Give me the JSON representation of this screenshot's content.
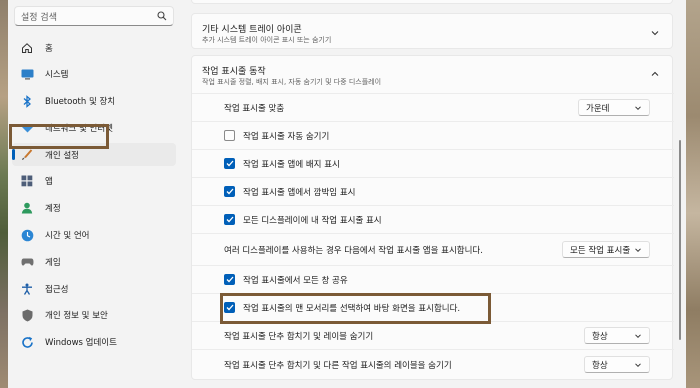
{
  "search": {
    "placeholder": "설정 검색"
  },
  "sidebar": {
    "items": [
      {
        "label": "홈",
        "icon": "home-icon"
      },
      {
        "label": "시스템",
        "icon": "monitor-icon"
      },
      {
        "label": "Bluetooth 및 장치",
        "icon": "bluetooth-icon"
      },
      {
        "label": "네트워크 및 인터넷",
        "icon": "wifi-icon"
      },
      {
        "label": "개인 설정",
        "icon": "paintbrush-icon",
        "active": true
      },
      {
        "label": "앱",
        "icon": "apps-icon"
      },
      {
        "label": "계정",
        "icon": "account-icon"
      },
      {
        "label": "시간 및 언어",
        "icon": "clock-globe-icon"
      },
      {
        "label": "게임",
        "icon": "gamepad-icon"
      },
      {
        "label": "접근성",
        "icon": "accessibility-icon"
      },
      {
        "label": "개인 정보 및 보안",
        "icon": "shield-icon"
      },
      {
        "label": "Windows 업데이트",
        "icon": "update-icon"
      }
    ]
  },
  "content": {
    "tray_icons": {
      "title": "기타 시스템 트레이 아이콘",
      "subtitle": "추가 시스템 트레이 아이콘 표시 또는 숨기기"
    },
    "behaviors": {
      "title": "작업 표시줄 동작",
      "subtitle": "작업 표시줄 정렬, 배지 표시, 자동 숨기기 및 다중 디스플레이",
      "alignment": {
        "label": "작업 표시줄 맞춤",
        "value": "가운데"
      },
      "checkboxes": [
        {
          "label": "작업 표시줄 자동 숨기기",
          "checked": false
        },
        {
          "label": "작업 표시줄 앱에 배지 표시",
          "checked": true
        },
        {
          "label": "작업 표시줄 앱에서 깜박임 표시",
          "checked": true
        },
        {
          "label": "모든 디스플레이에 내 작업 표시줄 표시",
          "checked": true
        }
      ],
      "multi_display": {
        "label": "여러 디스플레이를 사용하는 경우 다음에서 작업 표시줄 앱을 표시합니다.",
        "value": "모든 작업 표시줄"
      },
      "share_window": {
        "label": "작업 표시줄에서 모든 창 공유",
        "checked": true
      },
      "show_desktop": {
        "label": "작업 표시줄의 맨 모서리를 선택하여 바탕 화면을 표시합니다.",
        "checked": true
      },
      "combine": {
        "label": "작업 표시줄 단추 합치기 및 레이블 숨기기",
        "value": "항상"
      },
      "combine_other": {
        "label": "작업 표시줄 단추 합치기 및 다른 작업 표시줄의 레이블을 숨기기",
        "value": "항상"
      }
    }
  },
  "colors": {
    "accent": "#005fb8",
    "highlight_box": "#7b5a36"
  }
}
